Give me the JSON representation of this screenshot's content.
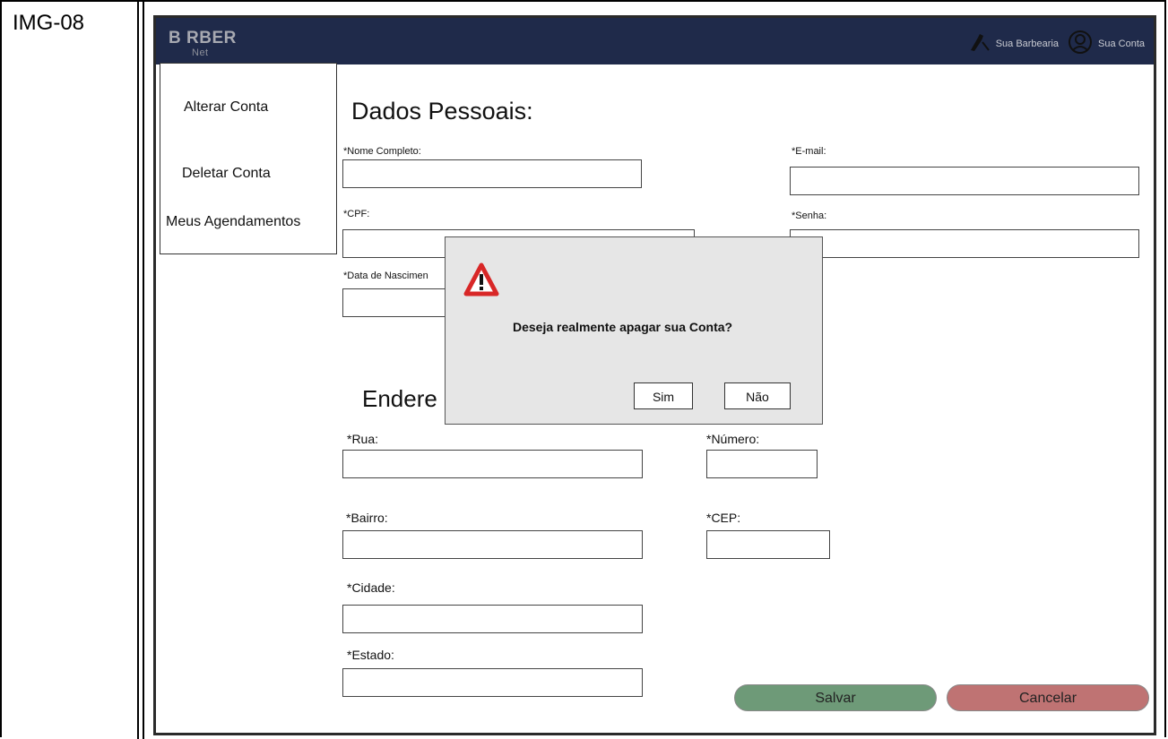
{
  "doc": {
    "label": "IMG-08"
  },
  "navbar": {
    "logo_main": "B RBER",
    "logo_sub": "Net",
    "barbershop_label": "Sua Barbearia",
    "account_label": "Sua Conta"
  },
  "sidebar": {
    "items": [
      {
        "label": "Alterar Conta"
      },
      {
        "label": "Deletar Conta"
      },
      {
        "label": "Meus Agendamentos"
      }
    ]
  },
  "personal": {
    "title": "Dados Pessoais:",
    "name_label": "*Nome Completo:",
    "email_label": "*E-mail:",
    "cpf_label": "*CPF:",
    "password_label": "*Senha:",
    "birth_label": "*Data de Nascimen"
  },
  "address": {
    "title": "Endere",
    "street_label": "*Rua:",
    "number_label": "*Número:",
    "district_label": "*Bairro:",
    "cep_label": "*CEP:",
    "city_label": "*Cidade:",
    "state_label": "*Estado:"
  },
  "actions": {
    "save_label": "Salvar",
    "cancel_label": "Cancelar"
  },
  "dialog": {
    "message": "Deseja realmente apagar sua Conta?",
    "yes_label": "Sim",
    "no_label": "Não"
  },
  "colors": {
    "navbar": "#1f2a4a",
    "save": "#6e9a78",
    "cancel": "#bf7373",
    "warning": "#d82727"
  }
}
